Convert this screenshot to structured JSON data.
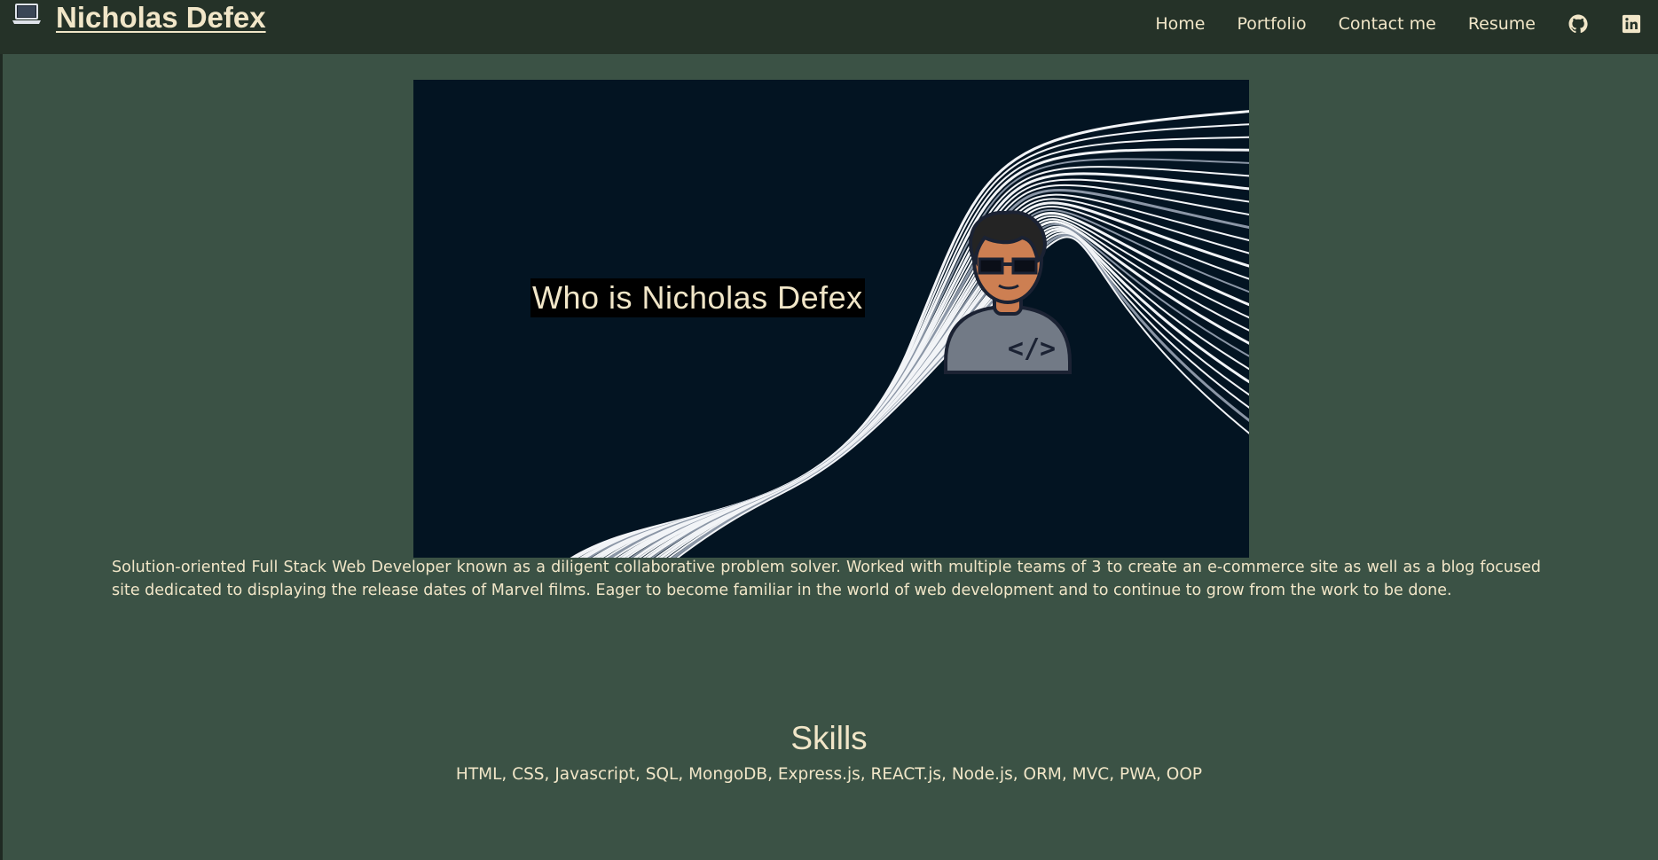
{
  "header": {
    "brand_icon": "laptop-icon",
    "brand_name": "Nicholas Defex",
    "nav": {
      "home": "Home",
      "portfolio": "Portfolio",
      "contact": "Contact me",
      "resume": "Resume"
    },
    "social_icons": [
      "github-icon",
      "linkedin-icon"
    ]
  },
  "hero": {
    "title": "Who is Nicholas Defex",
    "avatar_badge": "</>"
  },
  "bio": "Solution-oriented Full Stack Web Developer known as a diligent collaborative problem solver. Worked with multiple teams of 3 to create an e-commerce site as well as a blog focused site dedicated to displaying the release dates of Marvel films. Eager to become familiar in the world of web development and to continue to grow from the work to be done.",
  "skills": {
    "title": "Skills",
    "list": "HTML, CSS, Javascript, SQL, MongoDB, Express.js, REACT.js, Node.js, ORM, MVC, PWA, OOP"
  },
  "colors": {
    "page_bg": "#3b5245",
    "header_bg": "#253228",
    "text": "#f1e6c8",
    "hero_bg": "#031422"
  }
}
